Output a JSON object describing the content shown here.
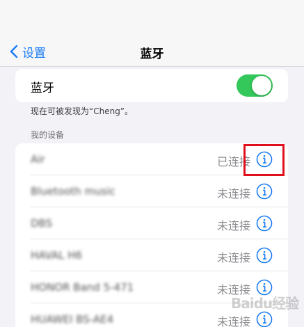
{
  "nav": {
    "back_label": "设置",
    "title": "蓝牙"
  },
  "bluetooth": {
    "label": "蓝牙",
    "enabled": true,
    "toggle_color": "#34c759"
  },
  "discoverable_text": "现在可被发现为“Cheng”。",
  "section_header": "我的设备",
  "devices": [
    {
      "name": "Air",
      "status": "已连接"
    },
    {
      "name": "Bluetooth music",
      "status": "未连接"
    },
    {
      "name": "DBS",
      "status": "未连接"
    },
    {
      "name": "HAVAL H6",
      "status": "未连接"
    },
    {
      "name": "HONOR Band 5-471",
      "status": "未连接"
    },
    {
      "name": "HUAWEI BS-AE4",
      "status": "未连接"
    }
  ],
  "accent_color": "#1a7cf5",
  "highlight_color": "#e0101e",
  "watermark": "Baidu经验"
}
